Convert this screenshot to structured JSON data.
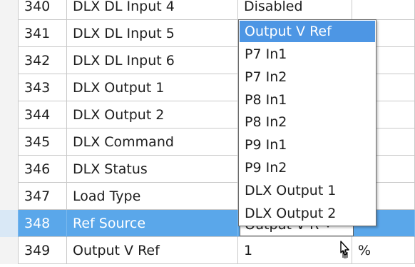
{
  "rows": [
    {
      "id": "340",
      "name": "DLX DL Input 4",
      "value": "Disabled",
      "unit": ""
    },
    {
      "id": "341",
      "name": "DLX DL Input 5",
      "value": "",
      "unit": ""
    },
    {
      "id": "342",
      "name": "DLX DL Input 6",
      "value": "",
      "unit": ""
    },
    {
      "id": "343",
      "name": "DLX Output 1",
      "value": "",
      "unit": ""
    },
    {
      "id": "344",
      "name": "DLX Output 2",
      "value": "",
      "unit": ""
    },
    {
      "id": "345",
      "name": "DLX Command",
      "value": "",
      "unit": ""
    },
    {
      "id": "346",
      "name": "DLX Status",
      "value": "",
      "unit": ""
    },
    {
      "id": "347",
      "name": "Load Type",
      "value": "",
      "unit": ""
    },
    {
      "id": "348",
      "name": "Ref Source",
      "value": "Output V R",
      "unit": ""
    },
    {
      "id": "349",
      "name": "Output V Ref",
      "value": "1",
      "unit": "%"
    }
  ],
  "dropdown": {
    "selected": "Output V Ref",
    "options": [
      "Output V Ref",
      "P7 In1",
      "P7 In2",
      "P8 In1",
      "P8 In2",
      "P9 In1",
      "P9 In2",
      "DLX Output 1",
      "DLX Output 2"
    ]
  },
  "colors": {
    "selected_row": "#5aa7ea",
    "highlight_option": "#4d96e4"
  }
}
